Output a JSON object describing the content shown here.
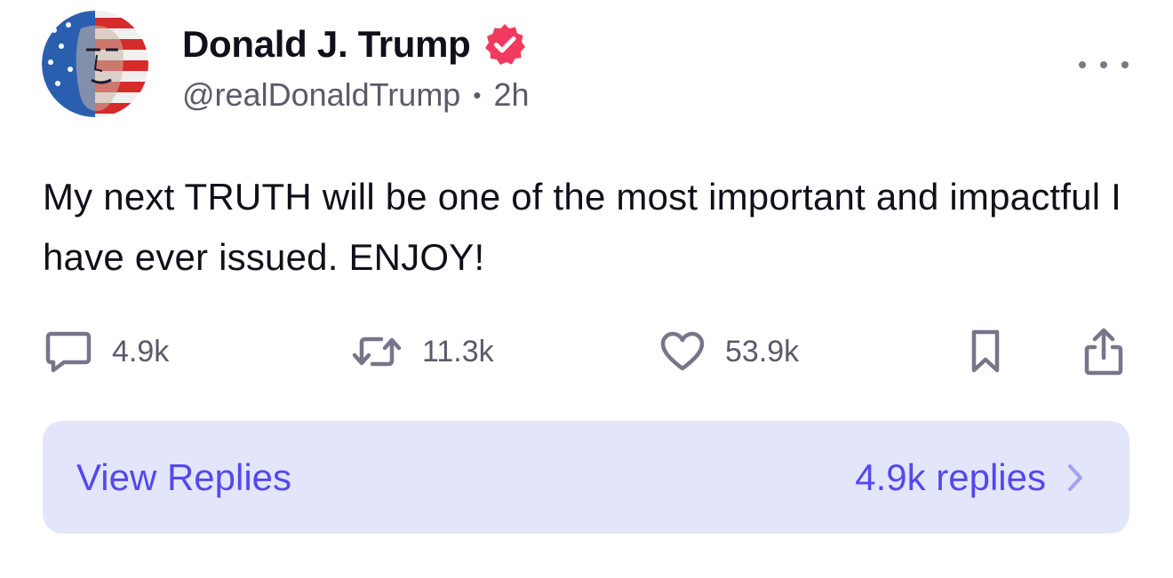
{
  "author": {
    "display_name": "Donald J. Trump",
    "handle": "@realDonaldTrump",
    "separator": "•",
    "time_ago": "2h",
    "verified": true,
    "avatar_icon": "avatar-american-flag-portrait"
  },
  "post": {
    "text": "My next TRUTH will be one of the most important and impactful I have ever issued. ENJOY!"
  },
  "actions": {
    "replies": {
      "icon": "comment-icon",
      "count": "4.9k"
    },
    "retruths": {
      "icon": "retruth-icon",
      "count": "11.3k"
    },
    "likes": {
      "icon": "heart-icon",
      "count": "53.9k"
    },
    "bookmark": {
      "icon": "bookmark-icon"
    },
    "share": {
      "icon": "share-icon"
    }
  },
  "replies_bar": {
    "label": "View Replies",
    "count_text": "4.9k replies"
  },
  "colors": {
    "verified": "#f23a5e",
    "accent": "#5448ee",
    "replies_bg": "#e3e6fb",
    "icon_gray": "#76758a",
    "text": "#11101a",
    "muted": "#5b5a6b"
  }
}
